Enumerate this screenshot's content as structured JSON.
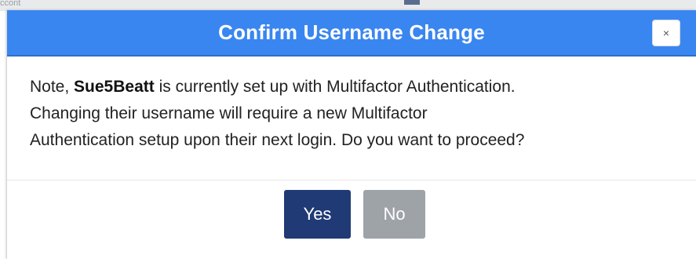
{
  "background": {
    "hint_text": "ccont"
  },
  "dialog": {
    "title": "Confirm Username Change",
    "close_label": "×",
    "message": {
      "prefix": "Note, ",
      "username": "Sue5Beatt",
      "line1_suffix": " is currently set up with Multifactor Authentication.",
      "line2": "Changing their username will require a new Multifactor",
      "line3": "Authentication setup upon their next login. Do you want to proceed?"
    },
    "buttons": {
      "yes": "Yes",
      "no": "No"
    }
  },
  "colors": {
    "header": "#3a86f0",
    "yes_button": "#1f3a74",
    "no_button": "#9ea3a8"
  }
}
